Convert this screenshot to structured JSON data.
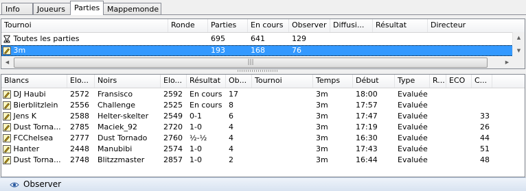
{
  "tabs": [
    {
      "label": "Info",
      "active": false
    },
    {
      "label": "Joueurs",
      "active": false
    },
    {
      "label": "Parties",
      "active": true
    },
    {
      "label": "Mappemonde",
      "active": false
    }
  ],
  "tournaments": {
    "columns": [
      "Tournoi",
      "Ronde",
      "Parties",
      "En cours",
      "Observer",
      "Diffusi...",
      "Résultat",
      "Directeur"
    ],
    "rows": [
      {
        "icon": "hourglass-icon",
        "tournoi": "Toutes les parties",
        "ronde": "",
        "parties": "695",
        "en_cours": "641",
        "observer": "129",
        "selected": false
      },
      {
        "icon": "pencil-icon",
        "tournoi": "3m",
        "ronde": "",
        "parties": "193",
        "en_cours": "168",
        "observer": "76",
        "selected": true
      }
    ]
  },
  "games": {
    "columns": [
      "Blancs",
      "Elo...",
      "Noirs",
      "Elo...",
      "Résultat",
      "Ob...",
      "Tournoi",
      "Temps",
      "Début",
      "Type",
      "R...",
      "ECO",
      "C..."
    ],
    "rows": [
      {
        "blancs": "DJ Haubi",
        "elo1": "2572",
        "noirs": "Fransisco",
        "elo2": "2592",
        "resultat": "En cours",
        "obs": "17",
        "tournoi": "",
        "temps": "3m",
        "debut": "18:00",
        "type": "Evaluée",
        "r": "",
        "eco": "",
        "c": ""
      },
      {
        "blancs": "Bierblitzlein",
        "elo1": "2556",
        "noirs": "Challenge",
        "elo2": "2525",
        "resultat": "En cours",
        "obs": "8",
        "tournoi": "",
        "temps": "3m",
        "debut": "17:57",
        "type": "Evaluée",
        "r": "",
        "eco": "",
        "c": ""
      },
      {
        "blancs": "Jens K",
        "elo1": "2588",
        "noirs": "Helter-skelter",
        "elo2": "2549",
        "resultat": "0-1",
        "obs": "6",
        "tournoi": "",
        "temps": "3m",
        "debut": "17:47",
        "type": "Evaluée",
        "r": "",
        "eco": "",
        "c": "33"
      },
      {
        "blancs": "Dust Torna...",
        "elo1": "2785",
        "noirs": "Maciek_92",
        "elo2": "2720",
        "resultat": "1-0",
        "obs": "4",
        "tournoi": "",
        "temps": "3m",
        "debut": "17:19",
        "type": "Evaluée",
        "r": "",
        "eco": "",
        "c": "26"
      },
      {
        "blancs": "FCChelsea",
        "elo1": "2777",
        "noirs": "Dust Tornado",
        "elo2": "2760",
        "resultat": "½-½",
        "obs": "4",
        "tournoi": "",
        "temps": "3m",
        "debut": "16:30",
        "type": "Evaluée",
        "r": "",
        "eco": "",
        "c": "44"
      },
      {
        "blancs": "Hanter",
        "elo1": "2448",
        "noirs": "Manubibi",
        "elo2": "2574",
        "resultat": "1-0",
        "obs": "4",
        "tournoi": "",
        "temps": "3m",
        "debut": "17:43",
        "type": "Evaluée",
        "r": "",
        "eco": "",
        "c": "51"
      },
      {
        "blancs": "Dust Torna...",
        "elo1": "2748",
        "noirs": "Blitzzmaster",
        "elo2": "2857",
        "resultat": "1-0",
        "obs": "2",
        "tournoi": "",
        "temps": "3m",
        "debut": "16:44",
        "type": "Evaluée",
        "r": "",
        "eco": "",
        "c": "48"
      }
    ]
  },
  "status": {
    "label": "Observer",
    "icon": "eye-icon"
  },
  "scroll_grip": "|||"
}
